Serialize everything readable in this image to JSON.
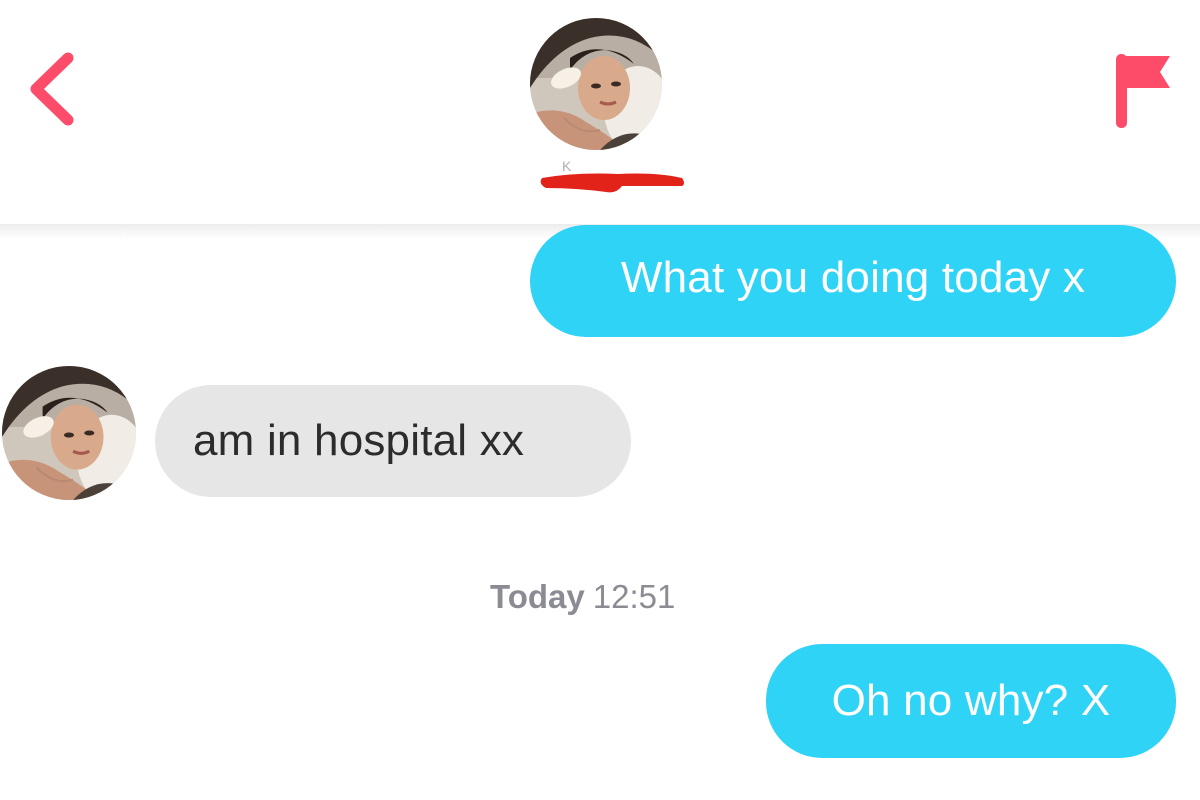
{
  "header": {
    "back_icon": "chevron-left-icon",
    "flag_icon": "flag-icon",
    "match_avatar": "profile-photo",
    "name_redacted": true,
    "accent_color": "#fd4c6a",
    "redaction_color": "#e2231a"
  },
  "messages": [
    {
      "direction": "sent",
      "text": "What you doing today x"
    },
    {
      "direction": "received",
      "text": "am in hospital xx"
    },
    {
      "direction": "sent",
      "text": "Oh no why? X"
    }
  ],
  "timestamp": {
    "day": "Today",
    "time": "12:51"
  },
  "colors": {
    "sent_bubble": "#2fd3f6",
    "received_bubble": "#e6e6e6",
    "timestamp_text": "#8b8b93"
  }
}
